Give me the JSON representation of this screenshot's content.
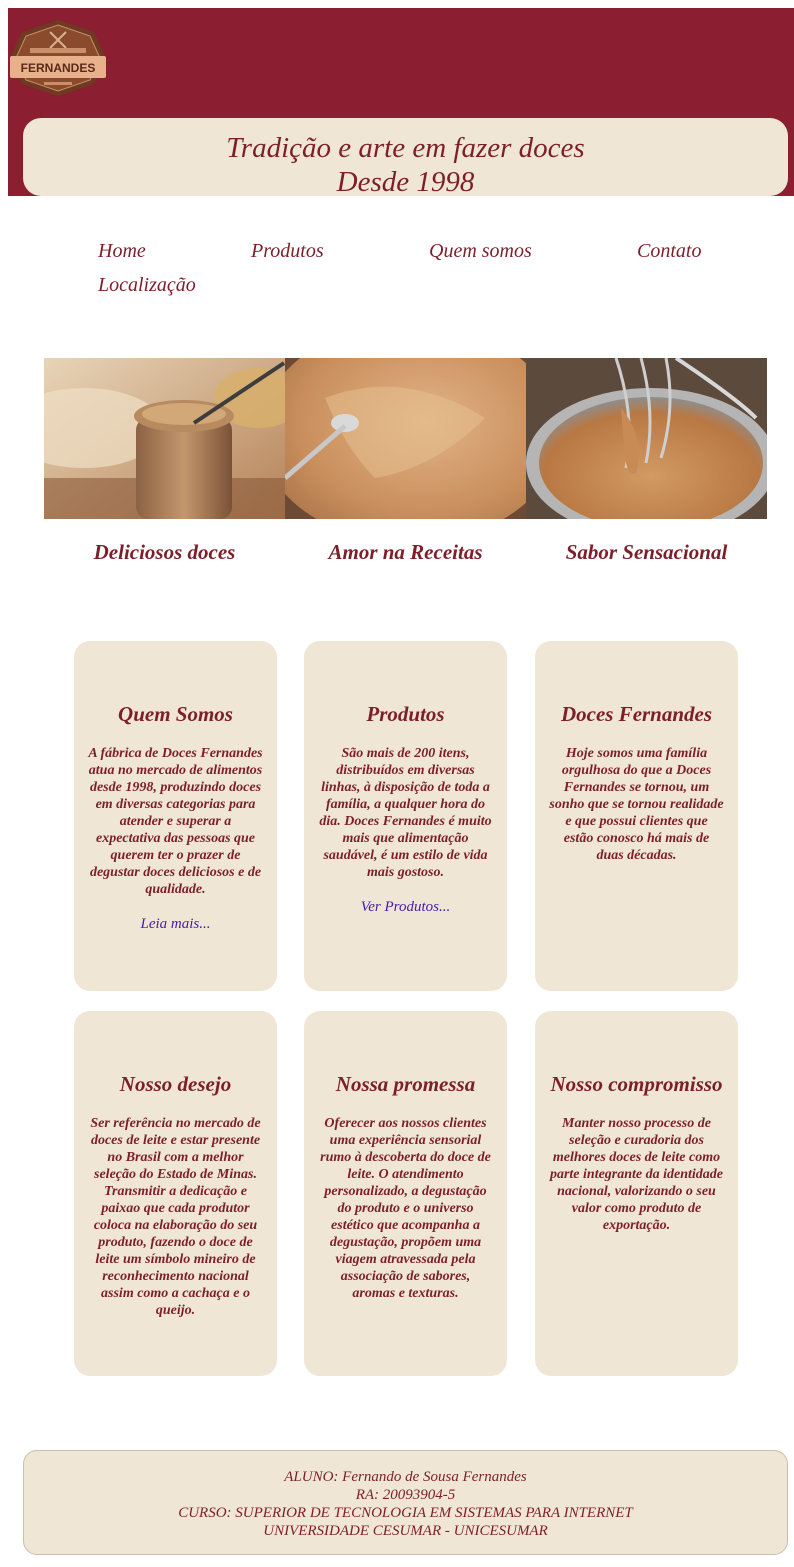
{
  "header": {
    "logo_text": "FERNANDES",
    "tagline_line1": "Tradição e arte em fazer doces",
    "tagline_line2": "Desde 1998"
  },
  "nav": {
    "items": [
      "Home",
      "Produtos",
      "Quem somos",
      "Contato",
      "Localização"
    ]
  },
  "gallery": {
    "captions": [
      "Deliciosos doces",
      "Amor na Receitas",
      "Sabor Sensacional"
    ]
  },
  "cards": [
    {
      "title": "Quem Somos",
      "text": "A fábrica de Doces Fernandes atua no mercado de alimentos desde 1998, produzindo doces em diversas categorias para atender e superar a expectativa das pessoas que querem ter o prazer de degustar doces deliciosos e de qualidade.",
      "link": "Leia mais..."
    },
    {
      "title": "Produtos",
      "text": "São mais de 200 itens, distribuídos em diversas linhas, à disposição de toda a família, a qualquer hora do dia. Doces Fernandes é muito mais que alimentação saudável, é um estilo de vida mais gostoso.",
      "link": "Ver Produtos..."
    },
    {
      "title": "Doces Fernandes",
      "text": "Hoje somos uma família orgulhosa do que a Doces Fernandes se tornou, um sonho que se tornou realidade e que possui clientes que estão conosco há mais de duas décadas."
    },
    {
      "title": "Nosso desejo",
      "text": "Ser referência no mercado de doces de leite e estar presente no Brasil com a melhor seleção do Estado de Minas. Transmitir a dedicação e paixao que cada produtor coloca na elaboração do seu produto, fazendo o doce de leite um símbolo mineiro de reconhecimento nacional assim como a cachaça e o queijo."
    },
    {
      "title": "Nossa promessa",
      "text": "Oferecer aos nossos clientes uma experiência sensorial rumo à descoberta do doce de leite. O atendimento personalizado, a degustação do produto e o universo estético que acompanha a degustação, propõem uma viagem atravessada pela associação de sabores, aromas e texturas."
    },
    {
      "title": "Nosso compromisso",
      "text": "Manter nosso processo de seleção e curadoria dos melhores doces de leite como parte integrante da identidade nacional, valorizando o seu valor como produto de exportação."
    }
  ],
  "footer": {
    "line1": "ALUNO: Fernando de Sousa Fernandes",
    "line2": "RA: 20093904-5",
    "line3": "CURSO: SUPERIOR DE TECNOLOGIA EM SISTEMAS PARA INTERNET",
    "line4": "UNIVERSIDADE CESUMAR - UNICESUMAR"
  },
  "colors": {
    "brand": "#8b1e30",
    "text": "#7d1f2a",
    "cream": "#efe6d6",
    "link": "#4a1aa8"
  }
}
